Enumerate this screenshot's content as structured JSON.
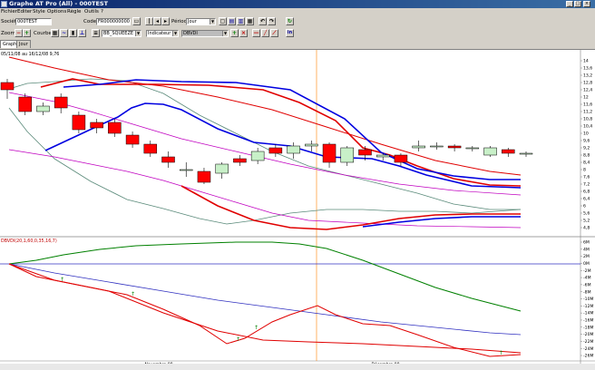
{
  "window": {
    "title": "Graphe AT Pro (All) - 000TEST"
  },
  "menu": [
    "Fichier",
    "Editer",
    "Style",
    "Options",
    "Règle",
    "Outils",
    "?"
  ],
  "toolbar1": {
    "societe_label": "Société",
    "societe_value": "000TEST",
    "code_label": "Code",
    "code_value": "FR0000000001",
    "periode_label": "Période",
    "periode_value": "Jour"
  },
  "toolbar2": {
    "zoom_label": "Zoom",
    "courbe_label": "Courbe",
    "indicator_value": "BB_SQUEEZE",
    "indicator_slot_value": "Indicateur 1",
    "second_indicator_value": "DBVDI"
  },
  "tabs": [
    "Graphe",
    "Jour"
  ],
  "price_pane": {
    "header": "05/11/08 au 16/12/08  9,76",
    "y_ticks": [
      "14",
      "13,6",
      "13,2",
      "12,8",
      "12,4",
      "12",
      "11,6",
      "11,2",
      "10,8",
      "10,4",
      "10",
      "9,6",
      "9,2",
      "8,8",
      "8,4",
      "8",
      "7,6",
      "7,2",
      "6,8",
      "6,4",
      "6",
      "5,6",
      "5,2",
      "4,8"
    ]
  },
  "indicator_pane": {
    "header": "DBVDI(20,1,60,0,35,16,7)",
    "y_ticks": [
      "6M",
      "4M",
      "2M",
      "0M",
      "-2M",
      "-4M",
      "-6M",
      "-8M",
      "-10M",
      "-12M",
      "-14M",
      "-16M",
      "-18M",
      "-20M",
      "-22M",
      "-24M",
      "-26M"
    ]
  },
  "x_axis": {
    "labels": [
      "Novembre 08",
      "Décembre 08"
    ]
  },
  "colors": {
    "candle_down": "#ff0000",
    "candle_up": "#c8f0c8",
    "ma_red": "#e00000",
    "ma_blue": "#0000e0",
    "bollinger": "#5a8a7a",
    "magenta": "#c000c0",
    "divider": "#ff8000"
  },
  "chart_data": {
    "type": "candlestick",
    "dates_range": "05/11/08 au 16/12/08",
    "candles": [
      {
        "o": 12.8,
        "c": 12.4,
        "h": 13.0,
        "l": 11.9
      },
      {
        "o": 12.0,
        "c": 11.2,
        "h": 12.2,
        "l": 11.0
      },
      {
        "o": 11.2,
        "c": 11.5,
        "h": 11.7,
        "l": 11.0
      },
      {
        "o": 12.0,
        "c": 11.4,
        "h": 12.2,
        "l": 11.1
      },
      {
        "o": 11.0,
        "c": 10.2,
        "h": 11.2,
        "l": 10.0
      },
      {
        "o": 10.6,
        "c": 10.3,
        "h": 10.8,
        "l": 10.0
      },
      {
        "o": 10.6,
        "c": 10.0,
        "h": 10.8,
        "l": 9.8
      },
      {
        "o": 9.9,
        "c": 9.4,
        "h": 10.1,
        "l": 9.2
      },
      {
        "o": 9.4,
        "c": 8.9,
        "h": 9.6,
        "l": 8.7
      },
      {
        "o": 8.7,
        "c": 8.4,
        "h": 9.0,
        "l": 8.1
      },
      {
        "o": 8.0,
        "c": 8.0,
        "h": 8.4,
        "l": 7.6
      },
      {
        "o": 7.9,
        "c": 7.3,
        "h": 8.1,
        "l": 7.2
      },
      {
        "o": 7.8,
        "c": 8.3,
        "h": 8.4,
        "l": 7.5
      },
      {
        "o": 8.6,
        "c": 8.4,
        "h": 8.8,
        "l": 8.2
      },
      {
        "o": 8.5,
        "c": 9.0,
        "h": 9.2,
        "l": 8.3
      },
      {
        "o": 9.2,
        "c": 8.9,
        "h": 9.4,
        "l": 8.7
      },
      {
        "o": 8.9,
        "c": 9.3,
        "h": 9.5,
        "l": 8.6
      },
      {
        "o": 9.3,
        "c": 9.4,
        "h": 9.6,
        "l": 9.0
      },
      {
        "o": 9.4,
        "c": 8.4,
        "h": 9.5,
        "l": 8.1
      },
      {
        "o": 8.4,
        "c": 9.2,
        "h": 9.3,
        "l": 8.2
      },
      {
        "o": 9.1,
        "c": 8.8,
        "h": 9.3,
        "l": 8.5
      },
      {
        "o": 8.7,
        "c": 8.8,
        "h": 8.9,
        "l": 8.5
      },
      {
        "o": 8.8,
        "c": 8.4,
        "h": 8.9,
        "l": 8.2
      },
      {
        "o": 9.2,
        "c": 9.3,
        "h": 9.6,
        "l": 9.0
      },
      {
        "o": 9.3,
        "c": 9.3,
        "h": 9.5,
        "l": 9.1
      },
      {
        "o": 9.3,
        "c": 9.2,
        "h": 9.4,
        "l": 9.0
      },
      {
        "o": 9.2,
        "c": 9.2,
        "h": 9.3,
        "l": 9.0
      },
      {
        "o": 8.8,
        "c": 9.2,
        "h": 9.3,
        "l": 8.7
      },
      {
        "o": 9.1,
        "c": 8.9,
        "h": 9.2,
        "l": 8.7
      },
      {
        "o": 8.9,
        "c": 8.9,
        "h": 9.0,
        "l": 8.7
      }
    ],
    "y_range": [
      4.8,
      14
    ],
    "indicator_range": [
      -26,
      6
    ]
  }
}
